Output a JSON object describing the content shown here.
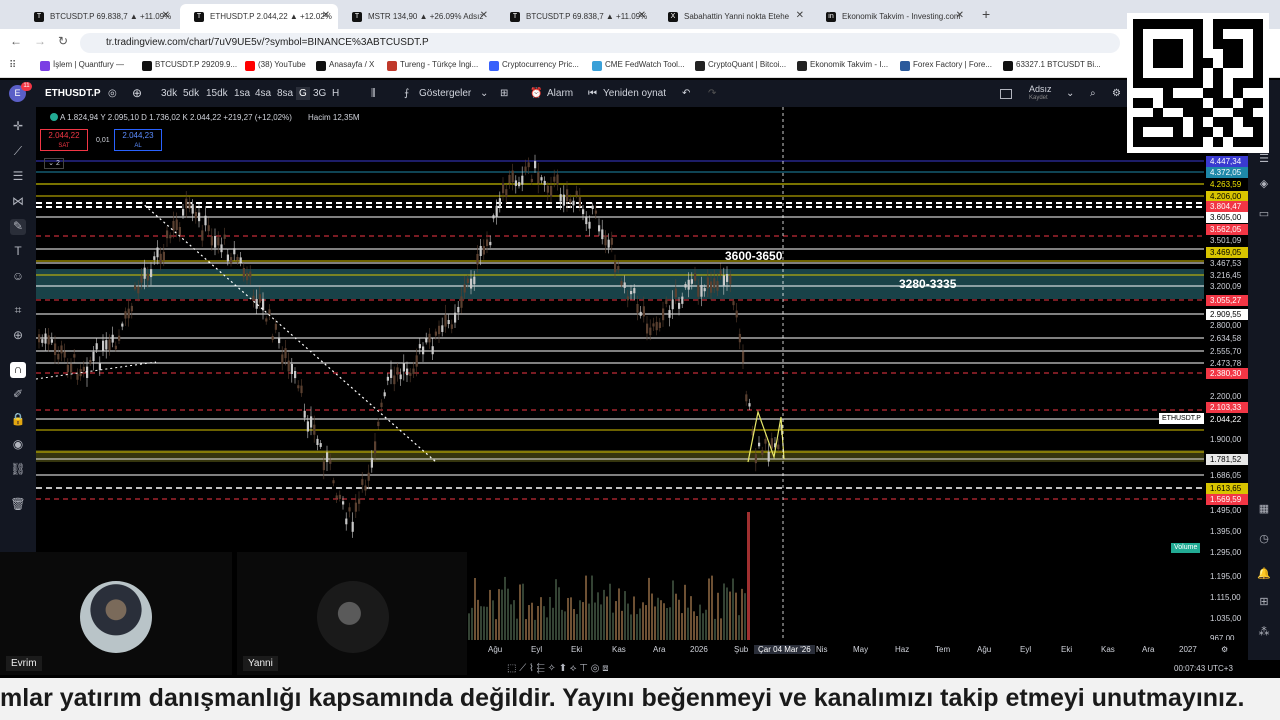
{
  "browser": {
    "tabs": [
      {
        "title": "BTCUSDT.P 69.838,7 ▲ +11.09%",
        "fav": "T",
        "active": false
      },
      {
        "title": "ETHUSDT.P 2.044,22 ▲ +12.02%",
        "fav": "T",
        "active": true
      },
      {
        "title": "MSTR 134,90 ▲ +26.09% Adsız",
        "fav": "T",
        "active": false
      },
      {
        "title": "BTCUSDT.P 69.838,7 ▲ +11.09%",
        "fav": "T",
        "active": false
      },
      {
        "title": "Sabahattin Yanni nokta Etehe",
        "fav": "X",
        "active": false
      },
      {
        "title": "Ekonomik Takvim - Investing.com",
        "fav": "in",
        "active": false
      }
    ],
    "url": "tr.tradingview.com/chart/7uV9UE5v/?symbol=BINANCE%3ABTCUSDT.P",
    "bookmarks": [
      {
        "label": "İşlem | Quantfury —",
        "color": "#7b3fe4"
      },
      {
        "label": "BTCUSDT.P 29209.9...",
        "color": "#111111"
      },
      {
        "label": "(38) YouTube",
        "color": "#ff0000"
      },
      {
        "label": "Anasayfa / X",
        "color": "#111111"
      },
      {
        "label": "Tureng - Türkçe İngi...",
        "color": "#c0392b"
      },
      {
        "label": "Cryptocurrency Pric...",
        "color": "#3861fb"
      },
      {
        "label": "CME FedWatch Tool...",
        "color": "#3aa0d8"
      },
      {
        "label": "CryptoQuant | Bitcoi...",
        "color": "#222222"
      },
      {
        "label": "Ekonomik Takvim - I...",
        "color": "#222222"
      },
      {
        "label": "Forex Factory | Fore...",
        "color": "#2b5a9c"
      },
      {
        "label": "63327.1 BTCUSDT Bi...",
        "color": "#111111"
      }
    ]
  },
  "toolbar": {
    "symbol": "ETHUSDT.P",
    "intervals": [
      "3dk",
      "5dk",
      "15dk",
      "1sa",
      "4sa",
      "8sa",
      "G",
      "3G",
      "H"
    ],
    "indicators": "Göstergeler",
    "alarm": "Alarm",
    "replay": "Yeniden oynat",
    "layout_name": "Adsız",
    "layout_status": "Kaydet"
  },
  "legend": {
    "ohlc": "A 1.824,94  Y 2.095,10  D 1.736,02  K 2.044,22 +219,27 (+12,02%)",
    "volume": "Hacim 12,35M",
    "sell_price": "2.044,22",
    "sell_label": "SAT",
    "spread": "0,01",
    "buy_price": "2.044,23",
    "buy_label": "AL",
    "collapse": "2"
  },
  "annotations": {
    "zone1": "3600-3650",
    "zone2": "3280-3335",
    "symbol_tag": "ETHUSDT.P",
    "volume_tag": "Volume",
    "crosshair_date": "Çar 04 Mar '26"
  },
  "price_axis": [
    {
      "v": "4.447,34",
      "bg": "#3a3ad0",
      "fg": "#ffffff"
    },
    {
      "v": "4.372,05",
      "bg": "#1e88a8",
      "fg": "#ffffff"
    },
    {
      "v": "4.263,59",
      "bg": "#000000",
      "fg": "#f2e600"
    },
    {
      "v": "4.206,00",
      "bg": "#d8c400",
      "fg": "#000000"
    },
    {
      "v": "3.804,47",
      "bg": "#f23645",
      "fg": "#ffffff"
    },
    {
      "v": "3.605,00",
      "bg": "#ffffff",
      "fg": "#000000"
    },
    {
      "v": "3.562,05",
      "bg": "#f23645",
      "fg": "#ffffff"
    },
    {
      "v": "3.501,09",
      "bg": "#000000",
      "fg": "#d1d4dc"
    },
    {
      "v": "3.469,05",
      "bg": "#d8c400",
      "fg": "#000000"
    },
    {
      "v": "3.467,53",
      "bg": "#000000",
      "fg": "#d1d4dc"
    },
    {
      "v": "3.216,45",
      "bg": "#000000",
      "fg": "#d1d4dc"
    },
    {
      "v": "3.200,09",
      "bg": "#000000",
      "fg": "#d1d4dc"
    },
    {
      "v": "3.055,27",
      "bg": "#f23645",
      "fg": "#ffffff"
    },
    {
      "v": "2.909,55",
      "bg": "#ffffff",
      "fg": "#000000"
    },
    {
      "v": "2.800,00",
      "bg": "#000000",
      "fg": "#d1d4dc"
    },
    {
      "v": "2.634,58",
      "bg": "#000000",
      "fg": "#d1d4dc"
    },
    {
      "v": "2.555,70",
      "bg": "#000000",
      "fg": "#d1d4dc"
    },
    {
      "v": "2.473,78",
      "bg": "#000000",
      "fg": "#d1d4dc"
    },
    {
      "v": "2.380,30",
      "bg": "#f23645",
      "fg": "#ffffff"
    },
    {
      "v": "2.200,00",
      "bg": "#000000",
      "fg": "#d1d4dc"
    },
    {
      "v": "2.103,33",
      "bg": "#f23645",
      "fg": "#ffffff"
    },
    {
      "v": "2.044,22",
      "bg": "#000000",
      "fg": "#ffffff"
    },
    {
      "v": "1.900,00",
      "bg": "#000000",
      "fg": "#d1d4dc"
    },
    {
      "v": "1.781,52",
      "bg": "#e8e8e8",
      "fg": "#000000"
    },
    {
      "v": "1.686,05",
      "bg": "#000000",
      "fg": "#d1d4dc"
    },
    {
      "v": "1.613,65",
      "bg": "#d8c400",
      "fg": "#000000"
    },
    {
      "v": "1.569,59",
      "bg": "#f23645",
      "fg": "#ffffff"
    },
    {
      "v": "1.495,00",
      "bg": "#000000",
      "fg": "#d1d4dc"
    },
    {
      "v": "1.395,00",
      "bg": "#000000",
      "fg": "#d1d4dc"
    },
    {
      "v": "1.295,00",
      "bg": "#000000",
      "fg": "#d1d4dc"
    },
    {
      "v": "1.195,00",
      "bg": "#000000",
      "fg": "#d1d4dc"
    },
    {
      "v": "1.115,00",
      "bg": "#000000",
      "fg": "#d1d4dc"
    },
    {
      "v": "1.035,00",
      "bg": "#000000",
      "fg": "#d1d4dc"
    },
    {
      "v": "967,00",
      "bg": "#000000",
      "fg": "#d1d4dc"
    }
  ],
  "time_axis": [
    "Ağu",
    "Eyl",
    "Eki",
    "Kas",
    "Ara",
    "2026",
    "Şub",
    "Nis",
    "May",
    "Haz",
    "Tem",
    "Ağu",
    "Eyl",
    "Eki",
    "Kas",
    "Ara",
    "2027"
  ],
  "clock": "00:07:43 UTC+3",
  "cameras": [
    {
      "name": "Evrim"
    },
    {
      "name": "Yanni"
    }
  ],
  "ticker": "mlar yatırım danışmanlığı kapsamında değildir. Yayını beğenmeyi ve kanalımızı takip etmeyi unutmayınız.",
  "colors": {
    "tv_bg": "#131722",
    "sell_red": "#f23645",
    "buy_blue": "#2962ff",
    "level_yellow": "#d8c400",
    "teal_zone": "#1d4e55"
  }
}
